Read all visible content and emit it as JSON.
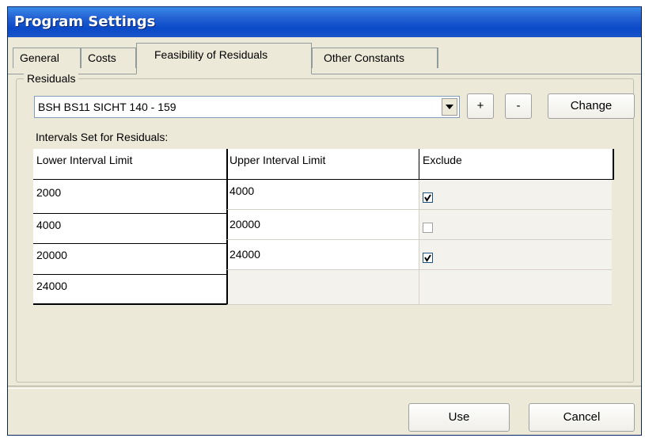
{
  "window": {
    "title": "Program Settings"
  },
  "tabs": [
    {
      "label": "General",
      "active": false
    },
    {
      "label": "Costs",
      "active": false
    },
    {
      "label": "Feasibility of Residuals",
      "active": true
    },
    {
      "label": "Other Constants",
      "active": false
    }
  ],
  "residuals": {
    "group_label": "Residuals",
    "selected": "BSH BS11 SICHT 140 - 159",
    "plus_label": "+",
    "minus_label": "-",
    "change_label": "Change"
  },
  "intervals": {
    "label": "Intervals Set for Residuals:",
    "columns": [
      "Lower Interval Limit",
      "Upper Interval Limit",
      "Exclude"
    ],
    "rows": [
      {
        "lower": "2000",
        "upper": "4000",
        "exclude": true
      },
      {
        "lower": "4000",
        "upper": "20000",
        "exclude": false
      },
      {
        "lower": "20000",
        "upper": "24000",
        "exclude": true
      },
      {
        "lower": "24000",
        "upper": "",
        "exclude": null
      }
    ]
  },
  "footer": {
    "use_label": "Use",
    "cancel_label": "Cancel"
  }
}
